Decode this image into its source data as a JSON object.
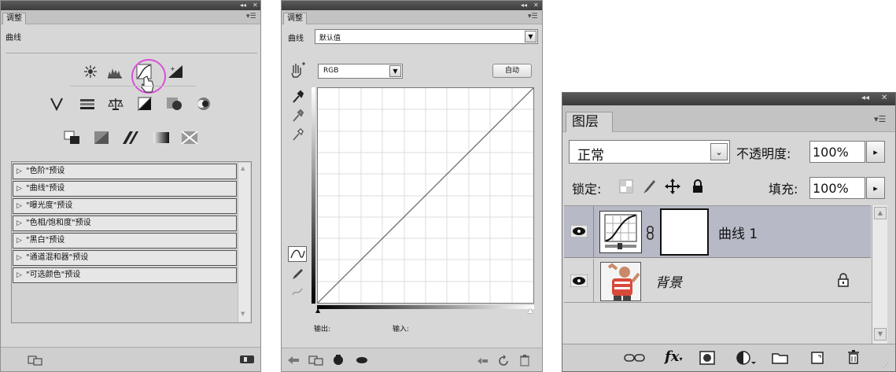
{
  "panel_adjust": {
    "tab": "调整",
    "subtitle": "曲线",
    "presets": [
      "\"色阶\"预设",
      "\"曲线\"预设",
      "\"曝光度\"预设",
      "\"色相/饱和度\"预设",
      "\"黑白\"预设",
      "\"通道混和器\"预设",
      "\"可选颜色\"预设"
    ]
  },
  "panel_curves": {
    "tab": "调整",
    "preset_label": "曲线",
    "preset_value": "默认值",
    "channel_value": "RGB",
    "auto_label": "自动",
    "output_label": "输出:",
    "input_label": "输入:"
  },
  "panel_layers": {
    "tab": "图层",
    "blend_mode": "正常",
    "opacity_label": "不透明度:",
    "opacity_value": "100%",
    "lock_label": "锁定:",
    "fill_label": "填充:",
    "fill_value": "100%",
    "layers": [
      {
        "name": "曲线 1",
        "selected": true
      },
      {
        "name": "背景",
        "selected": false
      }
    ]
  },
  "colors": {
    "highlight_circle": "#d84fd8",
    "selected_layer": "#b7bac6"
  }
}
